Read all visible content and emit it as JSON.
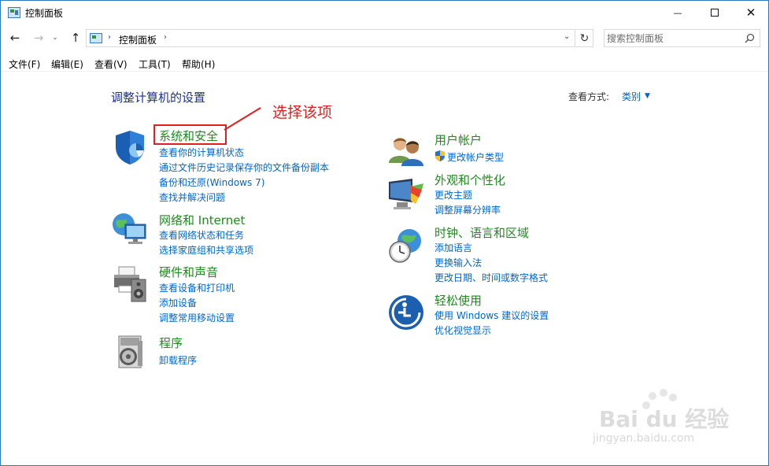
{
  "window": {
    "title": "控制面板",
    "minimize_glyph": "—",
    "close_glyph": "✕"
  },
  "nav": {
    "back_glyph": "←",
    "forward_glyph": "→",
    "recent_glyph": "⌄",
    "up_glyph": "↑",
    "breadcrumb": "控制面板",
    "separator": "›",
    "dropdown_glyph": "⌄",
    "refresh_glyph": "↻",
    "search_placeholder": "搜索控制面板"
  },
  "menu": {
    "items": [
      "文件(F)",
      "编辑(E)",
      "查看(V)",
      "工具(T)",
      "帮助(H)"
    ]
  },
  "main": {
    "title": "调整计算机的设置",
    "viewby_label": "查看方式:",
    "viewby_value": "类别",
    "viewby_arrow": "▼"
  },
  "annotation": {
    "text": "选择该项",
    "color": "#e02020"
  },
  "categories": [
    {
      "title": "系统和安全",
      "icon": "shield-icon",
      "links": [
        "查看你的计算机状态",
        "通过文件历史记录保存你的文件备份副本",
        "备份和还原(Windows 7)",
        "查找并解决问题"
      ]
    },
    {
      "title": "网络和 Internet",
      "icon": "network-icon",
      "links": [
        "查看网络状态和任务",
        "选择家庭组和共享选项"
      ]
    },
    {
      "title": "硬件和声音",
      "icon": "printer-icon",
      "links": [
        "查看设备和打印机",
        "添加设备",
        "调整常用移动设置"
      ]
    },
    {
      "title": "程序",
      "icon": "programs-icon",
      "links": [
        "卸载程序"
      ]
    },
    {
      "title": "用户帐户",
      "icon": "users-icon",
      "links": [
        "更改帐户类型"
      ]
    },
    {
      "title": "外观和个性化",
      "icon": "display-icon",
      "links": [
        "更改主题",
        "调整屏幕分辨率"
      ]
    },
    {
      "title": "时钟、语言和区域",
      "icon": "clock-globe-icon",
      "links": [
        "添加语言",
        "更换输入法",
        "更改日期、时间或数字格式"
      ]
    },
    {
      "title": "轻松使用",
      "icon": "ease-of-access-icon",
      "links": [
        "使用 Windows 建议的设置",
        "优化视觉显示"
      ]
    }
  ],
  "watermark": {
    "text": "Bai du 经验",
    "url": "jingyan.baidu.com"
  },
  "colors": {
    "category_title": "#1f8a1f",
    "link": "#0066cc",
    "page_title": "#1e3287"
  }
}
